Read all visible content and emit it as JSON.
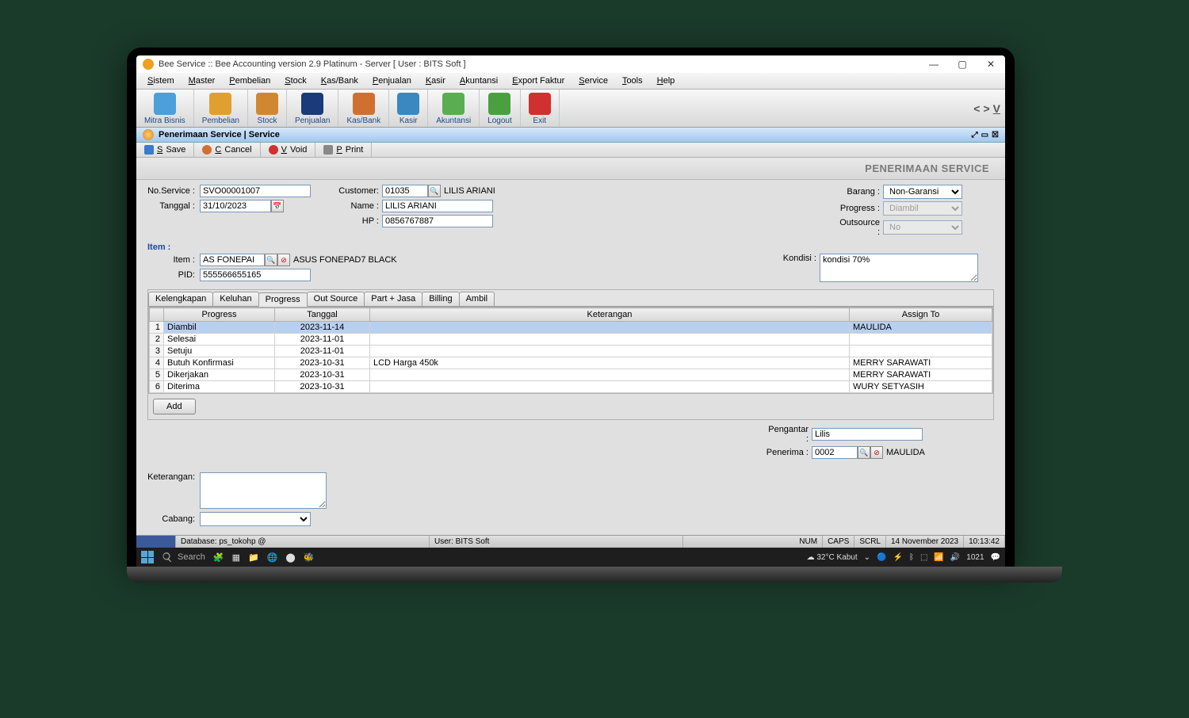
{
  "window": {
    "title": "Bee Service :: Bee Accounting version 2.9 Platinum - Server  [ User : BITS Soft ]"
  },
  "menu": [
    "Sistem",
    "Master",
    "Pembelian",
    "Stock",
    "Kas/Bank",
    "Penjualan",
    "Kasir",
    "Akuntansi",
    "Export Faktur",
    "Service",
    "Tools",
    "Help"
  ],
  "toolbar": [
    {
      "label": "Mitra Bisnis",
      "color": "#4c9fd8"
    },
    {
      "label": "Pembelian",
      "color": "#e0a030"
    },
    {
      "label": "Stock",
      "color": "#d08830"
    },
    {
      "label": "Penjualan",
      "color": "#1a3a7a"
    },
    {
      "label": "Kas/Bank",
      "color": "#d07030"
    },
    {
      "label": "Kasir",
      "color": "#3a88c0"
    },
    {
      "label": "Akuntansi",
      "color": "#5aad50"
    },
    {
      "label": "Logout",
      "color": "#4aa040"
    },
    {
      "label": "Exit",
      "color": "#d03030"
    }
  ],
  "subtitle": "Penerimaan Service | Service",
  "actions": {
    "save": "Save",
    "cancel": "Cancel",
    "void": "Void",
    "print": "Print"
  },
  "page_title": "PENERIMAAN SERVICE",
  "form": {
    "no_service_lbl": "No.Service :",
    "no_service": "SVO00001007",
    "tanggal_lbl": "Tanggal :",
    "tanggal": "31/10/2023",
    "customer_lbl": "Customer:",
    "customer_code": "01035",
    "customer_name_short": "LILIS ARIANI",
    "name_lbl": "Name :",
    "name": "LILIS ARIANI",
    "hp_lbl": "HP :",
    "hp": "0856767887",
    "barang_lbl": "Barang :",
    "barang": "Non-Garansi",
    "progress_lbl": "Progress :",
    "progress": "Diambil",
    "outsource_lbl": "Outsource :",
    "outsource": "No",
    "item_header": "Item :",
    "item_lbl": "Item :",
    "item_code": "AS FONEPAI",
    "item_name": "ASUS FONEPAD7 BLACK",
    "pid_lbl": "PID:",
    "pid": "555566655165",
    "kondisi_lbl": "Kondisi :",
    "kondisi": "kondisi 70%",
    "add_btn": "Add",
    "pengantar_lbl": "Pengantar :",
    "pengantar": "Lilis",
    "penerima_lbl": "Penerima :",
    "penerima_code": "0002",
    "penerima_name": "MAULIDA",
    "keterangan_lbl": "Keterangan:",
    "cabang_lbl": "Cabang:"
  },
  "tabs": [
    "Kelengkapan",
    "Keluhan",
    "Progress",
    "Out Source",
    "Part + Jasa",
    "Billing",
    "Ambil"
  ],
  "active_tab": 2,
  "grid": {
    "headers": [
      "",
      "Progress",
      "Tanggal",
      "Keterangan",
      "Assign To"
    ],
    "rows": [
      {
        "n": "1",
        "progress": "Diambil",
        "tanggal": "2023-11-14",
        "ket": "",
        "assign": "MAULIDA"
      },
      {
        "n": "2",
        "progress": "Selesai",
        "tanggal": "2023-11-01",
        "ket": "",
        "assign": ""
      },
      {
        "n": "3",
        "progress": "Setuju",
        "tanggal": "2023-11-01",
        "ket": "",
        "assign": ""
      },
      {
        "n": "4",
        "progress": "Butuh Konfirmasi",
        "tanggal": "2023-10-31",
        "ket": "LCD Harga 450k",
        "assign": "MERRY SARAWATI"
      },
      {
        "n": "5",
        "progress": "Dikerjakan",
        "tanggal": "2023-10-31",
        "ket": "",
        "assign": "MERRY SARAWATI"
      },
      {
        "n": "6",
        "progress": "Diterima",
        "tanggal": "2023-10-31",
        "ket": "",
        "assign": "WURY SETYASIH"
      }
    ]
  },
  "status": {
    "db": "Database: ps_tokohp @",
    "user": "User: BITS Soft",
    "num": "NUM",
    "caps": "CAPS",
    "scrl": "SCRL",
    "date": "14 November 2023",
    "time": "10:13:42"
  },
  "taskbar": {
    "search": "Search",
    "weather": "32°C  Kabut",
    "time": "1021"
  }
}
